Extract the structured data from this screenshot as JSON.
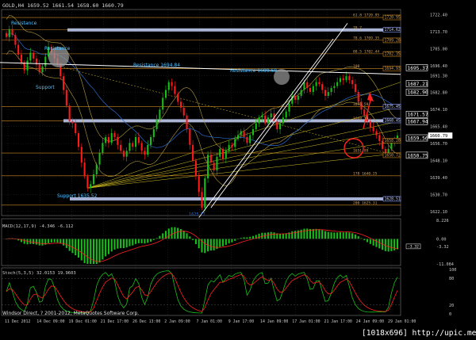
{
  "colors": {
    "background": "#000000",
    "grid": "#2a2a2a",
    "panel_border": "#7a7a7a",
    "bull_candle": "#16c016",
    "bear_candle": "#ff1a1a",
    "fib_line": "#d08a20",
    "fib_label": "#d0a060",
    "support_resistance": "#b8c4ea",
    "trendline": "#ffffff",
    "channel_line": "#d6c020",
    "ma_line": "#2a6ad0",
    "envelope": "#b8a040",
    "macd_hist_up": "#19c019",
    "macd_hist_down": "#e03030",
    "macd_signal": "#ff2020",
    "stoch_main": "#19c019",
    "stoch_signal": "#ff2020",
    "text": "#c8c8c8",
    "price_box_bg": "#000000",
    "price_box_fg": "#ffffff",
    "annotation": "#4ec0ff",
    "red_arrow": "#ff2020"
  },
  "header": {
    "ohlc": "GOLD,H4  1659.52 1661.54 1658.60 1660.79"
  },
  "chart_data": [
    {
      "type": "candlestick",
      "symbol": "GOLD",
      "timeframe": "H4",
      "ohlc": {
        "open": 1659.52,
        "high": 1661.54,
        "low": 1658.6,
        "close": 1660.79
      },
      "ylim": [
        1620,
        1725
      ],
      "y_ticks": [
        1722.4,
        1713.7,
        1705.0,
        1696.4,
        1691.3,
        1682.8,
        1674.1,
        1665.4,
        1660.79,
        1656.7,
        1648.1,
        1639.4,
        1630.7,
        1622.1
      ],
      "x_tick_labels": [
        "11 Dec 2012",
        "14 Dec 09:00",
        "19 Dec 01:00",
        "21 Dec 17:00",
        "26 Dec 13:00",
        "2 Jan 09:00",
        "7 Jan 01:00",
        "9 Jan 17:00",
        "14 Jan 09:00",
        "17 Jan 01:00",
        "21 Jan 17:00",
        "24 Jan 09:00",
        "29 Jan 01:00"
      ],
      "series": [
        {
          "name": "GOLD",
          "closes": [
            1711,
            1715,
            1712,
            1707,
            1702,
            1698,
            1694,
            1699,
            1703,
            1700,
            1697,
            1693,
            1696,
            1701,
            1706,
            1703,
            1700,
            1697,
            1691,
            1684,
            1676,
            1668,
            1667,
            1662,
            1655,
            1647,
            1640,
            1634,
            1636,
            1641,
            1646,
            1652,
            1657,
            1660,
            1657,
            1662,
            1660,
            1656,
            1653,
            1650,
            1653,
            1657,
            1655,
            1660,
            1657,
            1653,
            1651,
            1656,
            1660,
            1664,
            1669,
            1674,
            1680,
            1684,
            1688,
            1686,
            1682,
            1678,
            1675,
            1671,
            1664,
            1656,
            1648,
            1640,
            1632,
            1624,
            1639,
            1651,
            1647,
            1643,
            1650,
            1654,
            1649,
            1653,
            1656,
            1655,
            1659,
            1661,
            1663,
            1660,
            1657,
            1661,
            1664,
            1667,
            1670,
            1671,
            1667,
            1670,
            1672,
            1668,
            1664,
            1667,
            1670,
            1673,
            1677,
            1681,
            1679,
            1681,
            1684,
            1688,
            1685,
            1683,
            1686,
            1688,
            1687,
            1684,
            1681,
            1683,
            1685,
            1686,
            1688,
            1690,
            1689,
            1691,
            1689,
            1687,
            1683,
            1678,
            1674,
            1671,
            1668,
            1665,
            1663,
            1661,
            1658,
            1654,
            1652,
            1654,
            1657,
            1659,
            1660.79
          ]
        }
      ]
    },
    {
      "type": "bar",
      "indicator": "MACD(12,17,9)",
      "header": "MACD(12,17,9) -4.346 -6.112",
      "ylim": [
        -11.09,
        8.23
      ],
      "ticks": [
        "8.226",
        "0.00",
        "-3.32",
        "-11.084"
      ],
      "series": [
        {
          "name": "MACD",
          "values": []
        },
        {
          "name": "Signal",
          "values": []
        }
      ]
    },
    {
      "type": "line",
      "indicator": "Stoch(5,3,5)",
      "header": "Stoch(5,3,5) 32.0153 19.9603",
      "ylim": [
        0,
        100
      ],
      "ticks": [
        "100",
        "80",
        "20",
        "0"
      ],
      "series": [
        {
          "name": "%K",
          "values": []
        },
        {
          "name": "%D",
          "values": []
        }
      ]
    }
  ],
  "labels": {
    "resistance_top": "Resistance",
    "resistance_mid": "Resistance",
    "support_left": "Support",
    "resistance_1694": "Resistance 1694.84",
    "resistance_1689": "Resistance 1689.68",
    "support_1635": "Support 1635.52",
    "small_value": "1625.77"
  },
  "fib_levels": [
    {
      "label": "61.8 1720.95",
      "price": 1720.95
    },
    {
      "label": "78.7",
      "price": 1714.6
    },
    {
      "label": "78.6 1709.35",
      "price": 1709.35
    },
    {
      "label": "88.5 1702.44",
      "price": 1702.44
    },
    {
      "label": "100",
      "price": 1694.9
    },
    {
      "label": "1675.59",
      "price": 1675.59
    },
    {
      "label": "1668.19",
      "price": 1668.19
    },
    {
      "label": "1651.89",
      "price": 1651.89
    },
    {
      "label": "178 1640.25",
      "price": 1640.25
    },
    {
      "label": "200 1625.31",
      "price": 1625.31
    }
  ],
  "price_tags": [
    {
      "text": "1720.95",
      "price": 1720.95,
      "style": "orange"
    },
    {
      "text": "1714.62",
      "price": 1714.62,
      "style": "blue"
    },
    {
      "text": "1709.28",
      "price": 1709.28,
      "style": "orange"
    },
    {
      "text": "1702.35",
      "price": 1702.35,
      "style": "orange"
    },
    {
      "text": "1695.37",
      "price": 1695.37,
      "style": "white"
    },
    {
      "text": "1694.93",
      "price": 1694.93,
      "style": "orange"
    },
    {
      "text": "1687.21",
      "price": 1687.21,
      "style": "white"
    },
    {
      "text": "1682.90",
      "price": 1682.9,
      "style": "white"
    },
    {
      "text": "1675.45",
      "price": 1675.45,
      "style": "blue"
    },
    {
      "text": "1671.57",
      "price": 1671.57,
      "style": "white"
    },
    {
      "text": "1668.45",
      "price": 1668.45,
      "style": "blue"
    },
    {
      "text": "1667.94",
      "price": 1667.94,
      "style": "white"
    },
    {
      "text": "1660.79",
      "price": 1660.79,
      "style": "current"
    },
    {
      "text": "1659.56",
      "price": 1659.56,
      "style": "white"
    },
    {
      "text": "1658.20",
      "price": 1658.2,
      "style": "orange"
    },
    {
      "text": "1650.75",
      "price": 1650.75,
      "style": "white"
    },
    {
      "text": "1650.72",
      "price": 1650.72,
      "style": "orange"
    },
    {
      "text": "1628.51",
      "price": 1628.51,
      "style": "blue"
    }
  ],
  "footer": {
    "copyright": "Windsor Direct, ? 2001-2012, MetaQuotes Software Corp.",
    "watermark": "[1018x696] http://upic.me/"
  }
}
